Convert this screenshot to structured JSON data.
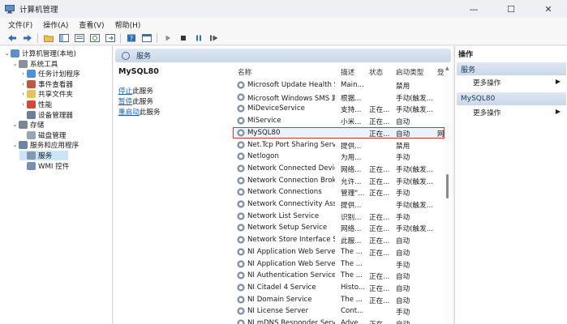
{
  "window": {
    "title": "计算机管理",
    "minimize": "—",
    "maximize": "☐",
    "close": "✕"
  },
  "menu": [
    "文件(F)",
    "操作(A)",
    "查看(V)",
    "帮助(H)"
  ],
  "tree": {
    "items": [
      {
        "label": "计算机管理(本地)",
        "level": 0,
        "twist": "⌄",
        "icon": "computer-icon"
      },
      {
        "label": "系统工具",
        "level": 1,
        "twist": "⌄",
        "icon": "tools-icon"
      },
      {
        "label": "任务计划程序",
        "level": 2,
        "twist": "›",
        "icon": "clock-icon"
      },
      {
        "label": "事件查看器",
        "level": 2,
        "twist": "›",
        "icon": "event-icon"
      },
      {
        "label": "共享文件夹",
        "level": 2,
        "twist": "›",
        "icon": "folder-icon"
      },
      {
        "label": "性能",
        "level": 2,
        "twist": "›",
        "icon": "performance-icon"
      },
      {
        "label": "设备管理器",
        "level": 2,
        "twist": "",
        "icon": "device-icon"
      },
      {
        "label": "存储",
        "level": 1,
        "twist": "⌄",
        "icon": "storage-icon"
      },
      {
        "label": "磁盘管理",
        "level": 2,
        "twist": "",
        "icon": "disk-icon"
      },
      {
        "label": "服务和应用程序",
        "level": 1,
        "twist": "⌄",
        "icon": "apps-icon"
      },
      {
        "label": "服务",
        "level": 2,
        "twist": "",
        "icon": "gear-icon",
        "selected": true
      },
      {
        "label": "WMI 控件",
        "level": 2,
        "twist": "",
        "icon": "wmi-icon"
      }
    ]
  },
  "services_header": "服务",
  "description": {
    "name": "MySQL80",
    "stop_link": "停止",
    "stop_suffix": "此服务",
    "pause_link": "暂停",
    "pause_suffix": "此服务",
    "restart_link": "重启动",
    "restart_suffix": "此服务"
  },
  "table": {
    "sort_indicator": "^",
    "columns": [
      "名称",
      "描述",
      "状态",
      "启动类型",
      "登"
    ],
    "rows": [
      {
        "name": "Microsoft Update Health S...",
        "desc": "Main...",
        "status": "",
        "startup": "禁用",
        "logon": ""
      },
      {
        "name": "Microsoft Windows SMS 路...",
        "desc": "根据...",
        "status": "",
        "startup": "手动(触发...",
        "logon": ""
      },
      {
        "name": "MiDeviceService",
        "desc": "支持...",
        "status": "正在...",
        "startup": "手动(触发...",
        "logon": ""
      },
      {
        "name": "MiService",
        "desc": "小米...",
        "status": "正在...",
        "startup": "自动",
        "logon": ""
      },
      {
        "name": "MySQL80",
        "desc": "",
        "status": "正在...",
        "startup": "自动",
        "logon": "网",
        "selected": true
      },
      {
        "name": "Net.Tcp Port Sharing Service",
        "desc": "提供...",
        "status": "",
        "startup": "禁用",
        "logon": ""
      },
      {
        "name": "Netlogon",
        "desc": "为用...",
        "status": "",
        "startup": "手动",
        "logon": ""
      },
      {
        "name": "Network Connected Devic...",
        "desc": "网络...",
        "status": "正在...",
        "startup": "手动(触发...",
        "logon": ""
      },
      {
        "name": "Network Connection Broker",
        "desc": "允许...",
        "status": "正在...",
        "startup": "手动(触发...",
        "logon": ""
      },
      {
        "name": "Network Connections",
        "desc": "管理\"...",
        "status": "正在...",
        "startup": "手动",
        "logon": ""
      },
      {
        "name": "Network Connectivity Assis...",
        "desc": "提供...",
        "status": "",
        "startup": "手动(触发...",
        "logon": ""
      },
      {
        "name": "Network List Service",
        "desc": "识别...",
        "status": "正在...",
        "startup": "手动",
        "logon": ""
      },
      {
        "name": "Network Setup Service",
        "desc": "网络...",
        "status": "正在...",
        "startup": "手动(触发...",
        "logon": ""
      },
      {
        "name": "Network Store Interface Se...",
        "desc": "此服...",
        "status": "正在...",
        "startup": "自动",
        "logon": ""
      },
      {
        "name": "NI Application Web Server",
        "desc": "The ...",
        "status": "正在...",
        "startup": "自动",
        "logon": ""
      },
      {
        "name": "NI Application Web Server ...",
        "desc": "The ...",
        "status": "",
        "startup": "手动",
        "logon": ""
      },
      {
        "name": "NI Authentication Service",
        "desc": "The ...",
        "status": "正在...",
        "startup": "自动",
        "logon": ""
      },
      {
        "name": "NI Citadel 4 Service",
        "desc": "Histo...",
        "status": "正在...",
        "startup": "自动",
        "logon": ""
      },
      {
        "name": "NI Domain Service",
        "desc": "The ...",
        "status": "正在...",
        "startup": "自动",
        "logon": ""
      },
      {
        "name": "NI License Server",
        "desc": "Cont...",
        "status": "",
        "startup": "手动",
        "logon": ""
      },
      {
        "name": "NI mDNS Responder Servi...",
        "desc": "Adve...",
        "status": "正在...",
        "startup": "自动",
        "logon": ""
      }
    ]
  },
  "actions": {
    "title": "操作",
    "sections": [
      {
        "label": "服务",
        "item": "更多操作"
      },
      {
        "label": "MySQL80",
        "item": "更多操作"
      }
    ]
  }
}
